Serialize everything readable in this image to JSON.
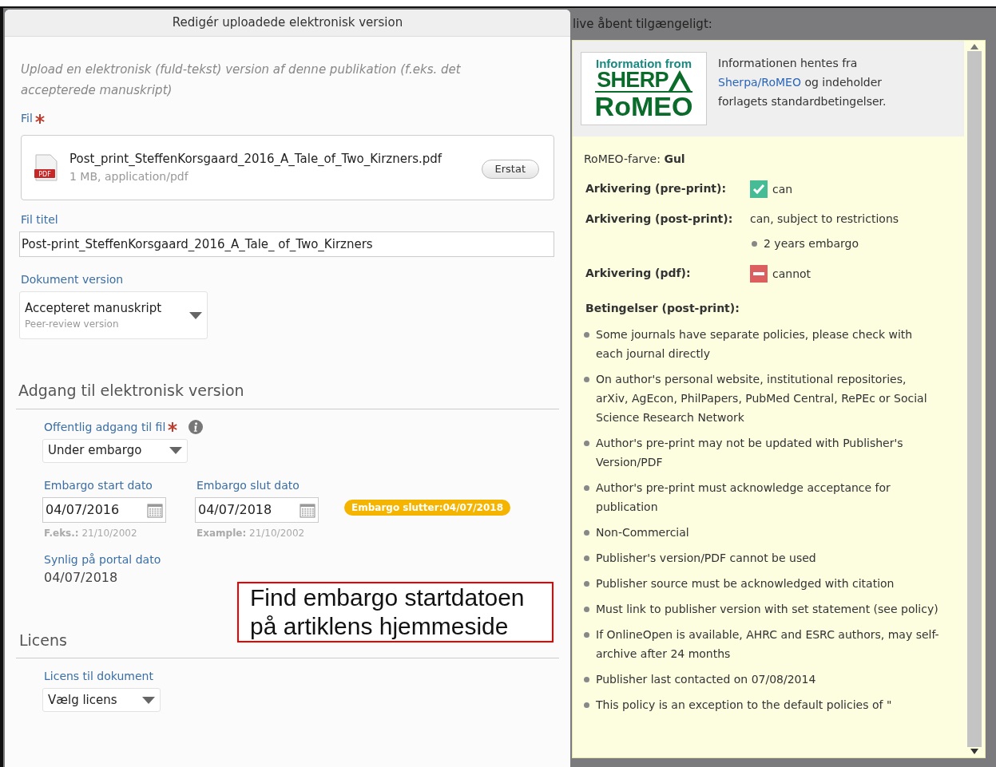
{
  "dialog": {
    "title": "Redigér uploadede elektronisk version",
    "intro": "Upload en elektronisk (fuld-tekst) version af denne publikation (f.eks. det accepterede manuskript)",
    "file_label": "Fil",
    "file_required": true,
    "file": {
      "name": "Post_print_SteffenKorsgaard_2016_A_Tale_of_Two_Kirzners.pdf",
      "meta": "1 MB, application/pdf",
      "button": "Erstat",
      "icon_text": "PDF"
    },
    "title_label": "Fil titel",
    "title_value": "Post-print_SteffenKorsgaard_2016_A_Tale_ of_Two_Kirzners",
    "version_label": "Dokument version",
    "version_value": "Accepteret manuskript",
    "version_sub": "Peer-review version",
    "access": {
      "heading": "Adgang til elektronisk version",
      "public_label": "Offentlig adgang til fil",
      "public_required": true,
      "public_value": "Under embargo",
      "start_label": "Embargo start dato",
      "start_value": "04/07/2016",
      "start_hint_label": "F.eks.:",
      "start_hint": "21/10/2002",
      "end_label": "Embargo slut dato",
      "end_value": "04/07/2018",
      "end_hint_label": "Example:",
      "end_hint": "21/10/2002",
      "badge": "Embargo slutter:04/07/2018",
      "visible_label": "Synlig på portal dato",
      "visible_value": "04/07/2018"
    },
    "license": {
      "heading": "Licens",
      "label": "Licens til dokument",
      "value": "Vælg licens"
    }
  },
  "annotation": {
    "lines": [
      "Find embargo startdatoen",
      "på artiklens hjemmeside"
    ]
  },
  "background_text": "live åbent tilgængeligt:",
  "romeo": {
    "logo": {
      "line1": "Information from",
      "line2": "SHERP",
      "line3": "RoMEO"
    },
    "info_before": "Informationen hentes fra",
    "info_link": "Sherpa/RoMEO",
    "info_after": "og indeholder forlagets standardbetingelser.",
    "colour_label": "RoMEO-farve:",
    "colour_value": "Gul",
    "archiving": [
      {
        "label": "Arkivering (pre-print):",
        "kind": "check",
        "value": "can"
      },
      {
        "label": "Arkivering (post-print):",
        "kind": "plain",
        "value": "can, subject to restrictions",
        "notes": [
          "2 years embargo"
        ]
      },
      {
        "label": "Arkivering (pdf):",
        "kind": "minus",
        "value": "cannot"
      }
    ],
    "conditions_label": "Betingelser (post-print):",
    "conditions": [
      "Some journals have separate policies, please check with each journal directly",
      "On author's personal website, institutional repositories, arXiv, AgEcon, PhilPapers, PubMed Central, RePEc or Social Science Research Network",
      "Author's pre-print may not be updated with Publisher's Version/PDF",
      "Author's pre-print must acknowledge acceptance for publication",
      "Non-Commercial",
      "Publisher's version/PDF cannot be used",
      "Publisher source must be acknowledged with citation",
      "Must link to publisher version with set statement (see policy)",
      "If OnlineOpen is available, AHRC and ESRC authors, may self-archive after 24 months",
      "Publisher last contacted on 07/08/2014",
      "This policy is an exception to the default policies of \""
    ]
  }
}
